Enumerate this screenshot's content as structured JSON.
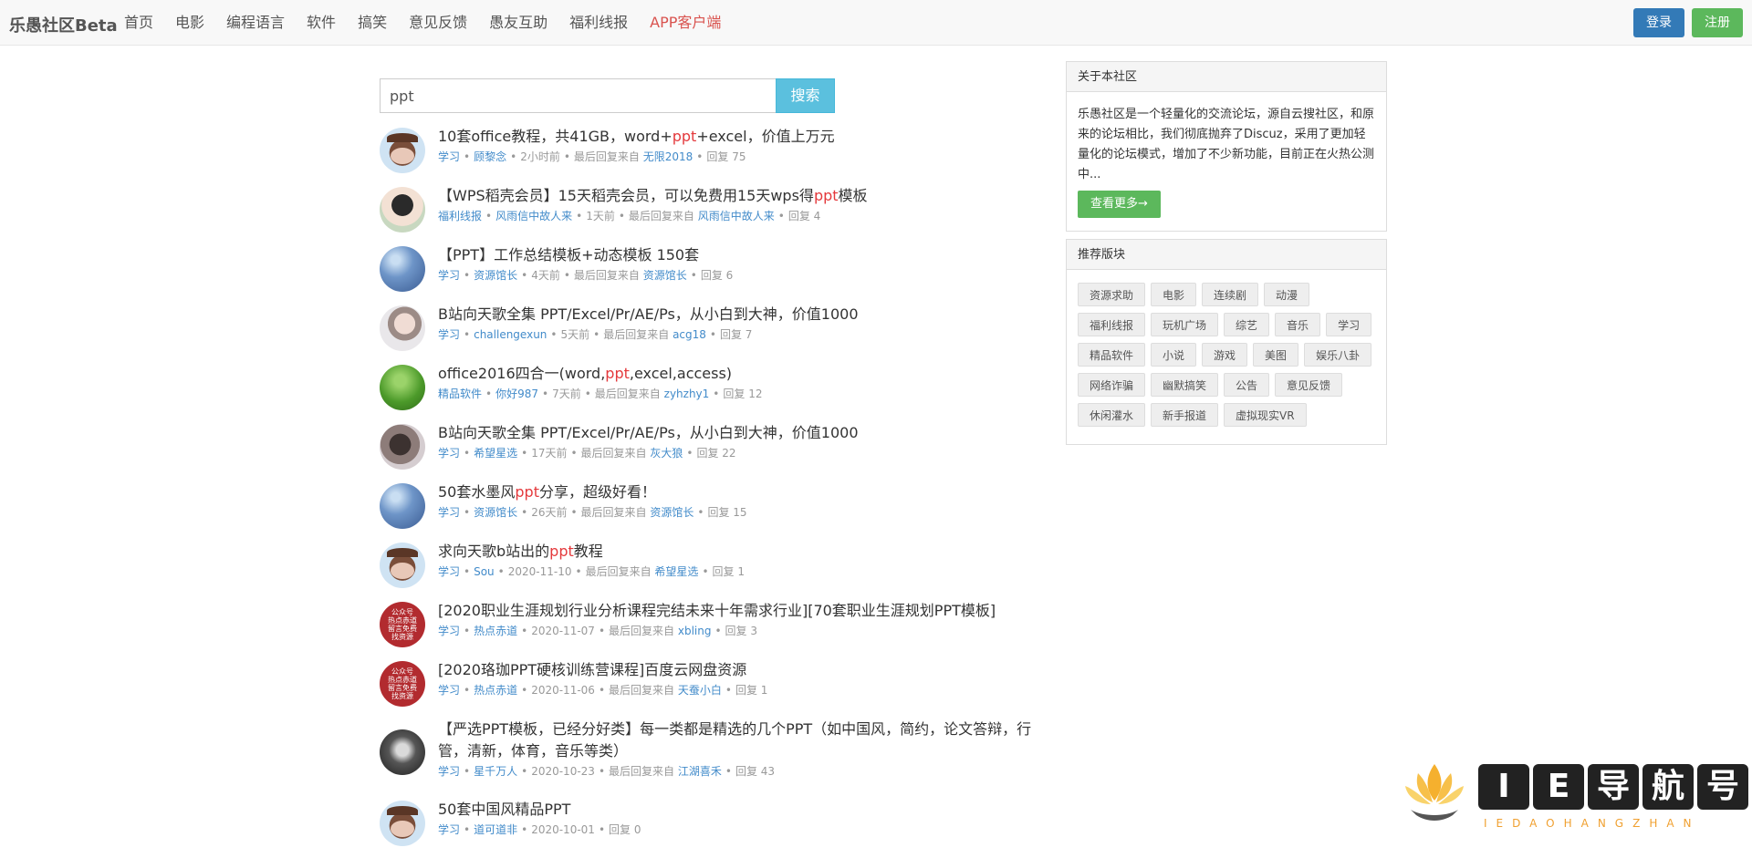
{
  "navbar": {
    "brand": "乐愚社区Beta",
    "items": [
      "首页",
      "电影",
      "编程语言",
      "软件",
      "搞笑",
      "意见反馈",
      "愚友互助",
      "福利线报",
      "APP客户端"
    ],
    "login": "登录",
    "register": "注册"
  },
  "search": {
    "value": "ppt",
    "button": "搜索"
  },
  "topics": [
    {
      "title": [
        "10套office教程，共41GB，word+",
        "ppt",
        "+excel，价值上万元"
      ],
      "category": "学习",
      "author": "顾黎念",
      "time": "2小时前",
      "last_label": "最后回复来自",
      "last_user": "无限2018",
      "replies": "回复 75"
    },
    {
      "title": [
        "【WPS稻壳会员】15天稻壳会员，可以免费用15天wps得",
        "ppt",
        "模板"
      ],
      "category": "福利线报",
      "author": "风雨信中故人来",
      "time": "1天前",
      "last_label": "最后回复来自",
      "last_user": "风雨信中故人来",
      "replies": "回复 4"
    },
    {
      "title": [
        "【PPT】工作总结模板+动态模板 150套",
        "",
        ""
      ],
      "category": "学习",
      "author": "资源馆长",
      "time": "4天前",
      "last_label": "最后回复来自",
      "last_user": "资源馆长",
      "replies": "回复 6"
    },
    {
      "title": [
        "B站向天歌全集 PPT/Excel/Pr/AE/Ps，从小白到大神，价值1000",
        "",
        ""
      ],
      "category": "学习",
      "author": "challengexun",
      "time": "5天前",
      "last_label": "最后回复来自",
      "last_user": "acg18",
      "replies": "回复 7"
    },
    {
      "title": [
        "office2016四合一(word,",
        "ppt",
        ",excel,access)"
      ],
      "category": "精品软件",
      "author": "你好987",
      "time": "7天前",
      "last_label": "最后回复来自",
      "last_user": "zyhzhy1",
      "replies": "回复 12"
    },
    {
      "title": [
        "B站向天歌全集 PPT/Excel/Pr/AE/Ps，从小白到大神，价值1000",
        "",
        ""
      ],
      "category": "学习",
      "author": "希望星选",
      "time": "17天前",
      "last_label": "最后回复来自",
      "last_user": "灰大狼",
      "replies": "回复 22"
    },
    {
      "title": [
        "50套水墨风",
        "ppt",
        "分享，超级好看！"
      ],
      "category": "学习",
      "author": "资源馆长",
      "time": "26天前",
      "last_label": "最后回复来自",
      "last_user": "资源馆长",
      "replies": "回复 15"
    },
    {
      "title": [
        "求向天歌b站出的",
        "ppt",
        "教程"
      ],
      "category": "学习",
      "author": "Sou",
      "time": "2020-11-10",
      "last_label": "最后回复来自",
      "last_user": "希望星选",
      "replies": "回复 1"
    },
    {
      "title": [
        "[2020职业生涯规划行业分析课程完结未来十年需求行业][70套职业生涯规划PPT模板]",
        "",
        ""
      ],
      "category": "学习",
      "author": "热点赤道",
      "time": "2020-11-07",
      "last_label": "最后回复来自",
      "last_user": "xbling",
      "replies": "回复 3"
    },
    {
      "title": [
        "[2020珞珈PPT硬核训练营课程]百度云网盘资源",
        "",
        ""
      ],
      "category": "学习",
      "author": "热点赤道",
      "time": "2020-11-06",
      "last_label": "最后回复来自",
      "last_user": "天蚕小白",
      "replies": "回复 1"
    },
    {
      "title": [
        "【严选PPT模板，已经分好类】每一类都是精选的几个PPT（如中国风，简约，论文答辩，行管，清新，体育，音乐等类）",
        "",
        ""
      ],
      "category": "学习",
      "author": "星千万人",
      "time": "2020-10-23",
      "last_label": "最后回复来自",
      "last_user": "江湖喜禾",
      "replies": "回复 43"
    },
    {
      "title": [
        "50套中国风精品PPT",
        "",
        ""
      ],
      "category": "学习",
      "author": "道可道非",
      "time": "2020-10-01",
      "last_label": "",
      "last_user": "",
      "replies": "回复 0"
    }
  ],
  "avatar_badge": [
    "公众号",
    "热点赤道",
    "留言免费",
    "找资源"
  ],
  "about": {
    "title": "关于本社区",
    "text": "乐愚社区是一个轻量化的交流论坛，源自云搜社区，和原来的论坛相比，我们彻底抛弃了Discuz，采用了更加轻量化的论坛模式，增加了不少新功能，目前正在火热公测中...",
    "more": "查看更多→"
  },
  "recommend": {
    "title": "推荐版块",
    "tags": [
      "资源求助",
      "电影",
      "连续剧",
      "动漫",
      "福利线报",
      "玩机广场",
      "综艺",
      "音乐",
      "学习",
      "精品软件",
      "小说",
      "游戏",
      "美图",
      "娱乐八卦",
      "网络诈骗",
      "幽默搞笑",
      "公告",
      "意见反馈",
      "休闲灌水",
      "新手报道",
      "虚拟现实VR"
    ]
  },
  "watermark": {
    "chars": [
      "I",
      "E",
      "导",
      "航",
      "号"
    ],
    "sub": "IEDAOHANGZHAN"
  }
}
